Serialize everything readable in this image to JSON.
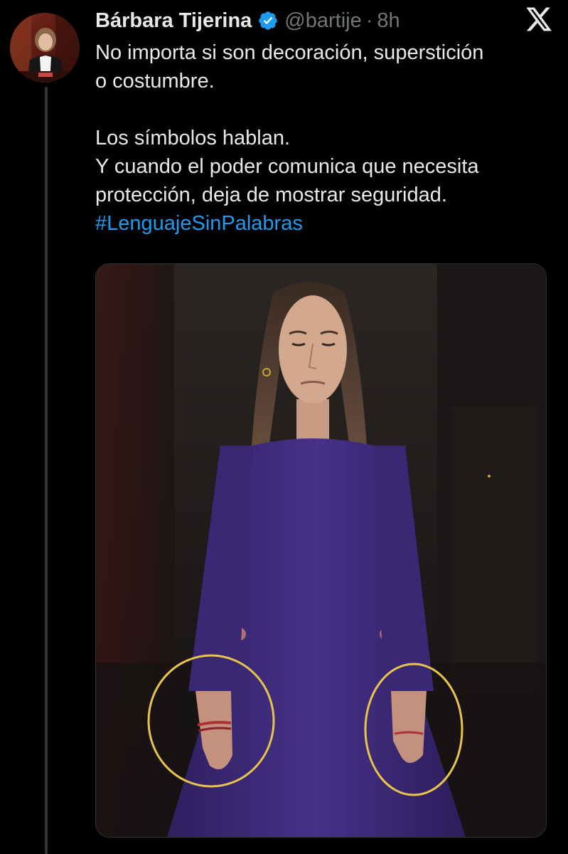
{
  "tweet": {
    "display_name": "Bárbara Tijerina",
    "handle": "@bartije",
    "separator": "·",
    "time": "8h",
    "body_lines": [
      "No importa si son decoración, superstición",
      "o costumbre.",
      "",
      "Los símbolos hablan.",
      "Y cuando el poder comunica que necesita",
      "protección, deja de mostrar seguridad."
    ],
    "hashtag": "#LenguajeSinPalabras"
  },
  "icons": {
    "verified": "verified-badge-icon",
    "platform": "x-logo-icon"
  },
  "colors": {
    "background": "#000000",
    "text": "#e7e9ea",
    "secondary_text": "#71767b",
    "link": "#1d9bf0",
    "verified": "#1d9bf0",
    "annotation_circle": "#e8c54a",
    "dress": "#3f2a7a"
  }
}
